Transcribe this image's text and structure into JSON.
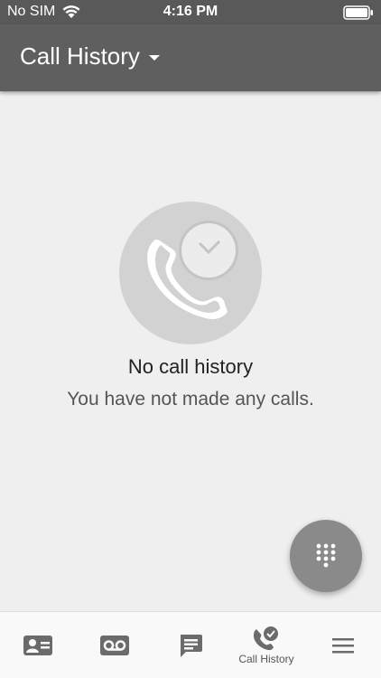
{
  "status_bar": {
    "carrier": "No SIM",
    "time": "4:16 PM"
  },
  "app_bar": {
    "title": "Call History"
  },
  "empty_state": {
    "title": "No call history",
    "subtitle": "You have not made any calls."
  },
  "fab": {
    "icon": "dialpad-icon"
  },
  "bottom_nav": {
    "items": [
      {
        "icon": "contacts-card-icon",
        "label": ""
      },
      {
        "icon": "voicemail-icon",
        "label": ""
      },
      {
        "icon": "message-icon",
        "label": ""
      },
      {
        "icon": "call-history-icon",
        "label": "Call History"
      },
      {
        "icon": "menu-icon",
        "label": ""
      }
    ]
  },
  "colors": {
    "app_bar": "#5f5f5f",
    "status_bar": "#595959",
    "background": "#efefef",
    "fab": "#8a8a8a",
    "illustration_circle": "#d2d2d2"
  }
}
